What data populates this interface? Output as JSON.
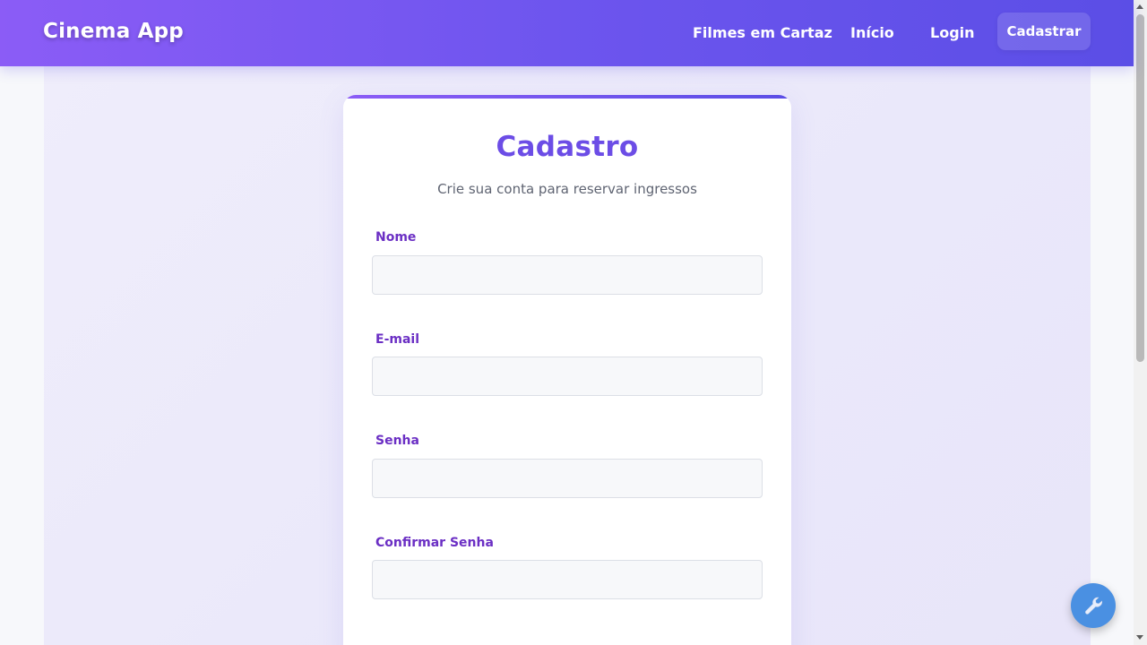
{
  "navbar": {
    "brand": "Cinema App",
    "links": [
      {
        "label": "Filmes em Cartaz"
      },
      {
        "label": "Início"
      },
      {
        "label": "Login"
      }
    ],
    "cta_label": "Cadastrar"
  },
  "form": {
    "title": "Cadastro",
    "subtitle": "Crie sua conta para reservar ingressos",
    "fields": [
      {
        "label": "Nome",
        "value": ""
      },
      {
        "label": "E-mail",
        "value": ""
      },
      {
        "label": "Senha",
        "value": ""
      },
      {
        "label": "Confirmar Senha",
        "value": ""
      }
    ]
  },
  "fab": {
    "icon": "wrench-icon"
  },
  "colors": {
    "accent": "#6c4de6",
    "label": "#6b2fc4",
    "nav_gradient_start": "#8b5cf6",
    "nav_gradient_end": "#5b4ee6",
    "fab": "#4a90e2"
  }
}
